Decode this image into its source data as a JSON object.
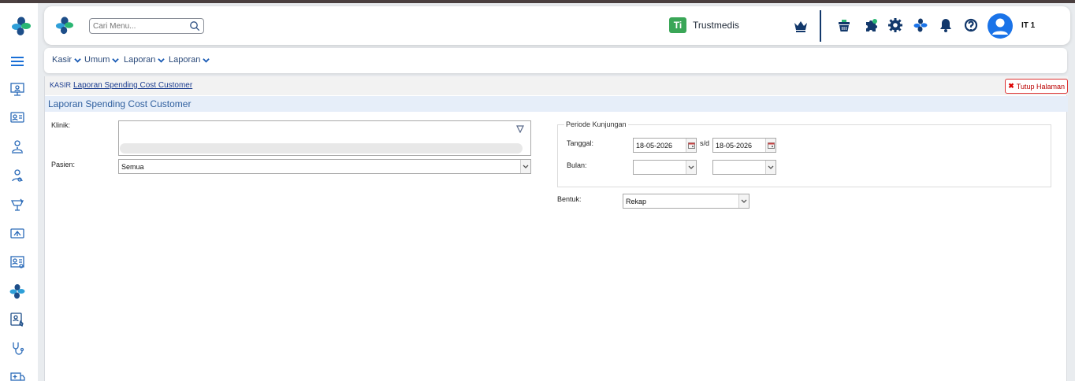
{
  "search": {
    "placeholder": "Cari Menu..."
  },
  "brand": {
    "mark": "Ti",
    "name": "Trustmedis"
  },
  "user": {
    "name": "IT 1"
  },
  "menu": [
    {
      "label": "Kasir"
    },
    {
      "label": "Umum"
    },
    {
      "label": "Laporan"
    },
    {
      "label": "Laporan"
    }
  ],
  "breadcrumb": {
    "root": "KASIR",
    "current": "Laporan Spending Cost Customer"
  },
  "close_button": "Tutup Halaman",
  "page_title": "Laporan Spending Cost Customer",
  "form": {
    "klinik_label": "Klinik:",
    "pasien_label": "Pasien:",
    "pasien_value": "Semua",
    "periode_legend": "Periode Kunjungan",
    "tanggal_label": "Tanggal:",
    "tanggal_from": "18-05-2026",
    "sd_label": "s/d",
    "tanggal_to": "18-05-2026",
    "bulan_label": "Bulan:",
    "bulan_from": "",
    "bulan_to": "",
    "bentuk_label": "Bentuk:",
    "bentuk_value": "Rekap"
  },
  "colors": {
    "brand_green": "#3aa657",
    "brand_blue": "#1a73e8",
    "icon_navy": "#12386b",
    "close_red": "#d33333",
    "title_bar": "#e6eef9"
  },
  "sidebar_icons": [
    "menu-icon",
    "presentation-icon",
    "id-card-icon",
    "doctor-icon",
    "user-outline-icon",
    "pharmacy-icon",
    "cashier-icon",
    "report-card-icon",
    "plus-logo-icon",
    "patient-select-icon",
    "stethoscope-icon",
    "ambulance-icon"
  ],
  "header_icons": [
    "crown-icon",
    "shopping-basket-icon",
    "puzzle-icon",
    "gear-icon",
    "plus-logo-icon",
    "bell-icon",
    "support-icon"
  ]
}
